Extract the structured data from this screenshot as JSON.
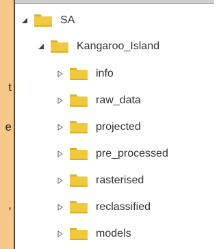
{
  "left_fragments": [
    "t",
    "e",
    ","
  ],
  "tree": {
    "nodes": [
      {
        "label": "SA",
        "level": 0,
        "expanded": true
      },
      {
        "label": "Kangaroo_Island",
        "level": 1,
        "expanded": true
      },
      {
        "label": "info",
        "level": 2,
        "expanded": false
      },
      {
        "label": "raw_data",
        "level": 2,
        "expanded": false
      },
      {
        "label": "projected",
        "level": 2,
        "expanded": false
      },
      {
        "label": "pre_processed",
        "level": 2,
        "expanded": false
      },
      {
        "label": "rasterised",
        "level": 2,
        "expanded": false
      },
      {
        "label": "reclassified",
        "level": 2,
        "expanded": false
      },
      {
        "label": "models",
        "level": 2,
        "expanded": false
      }
    ]
  },
  "colors": {
    "folder": "#f0c93f",
    "panel": "#f6c889",
    "text": "#333333"
  }
}
